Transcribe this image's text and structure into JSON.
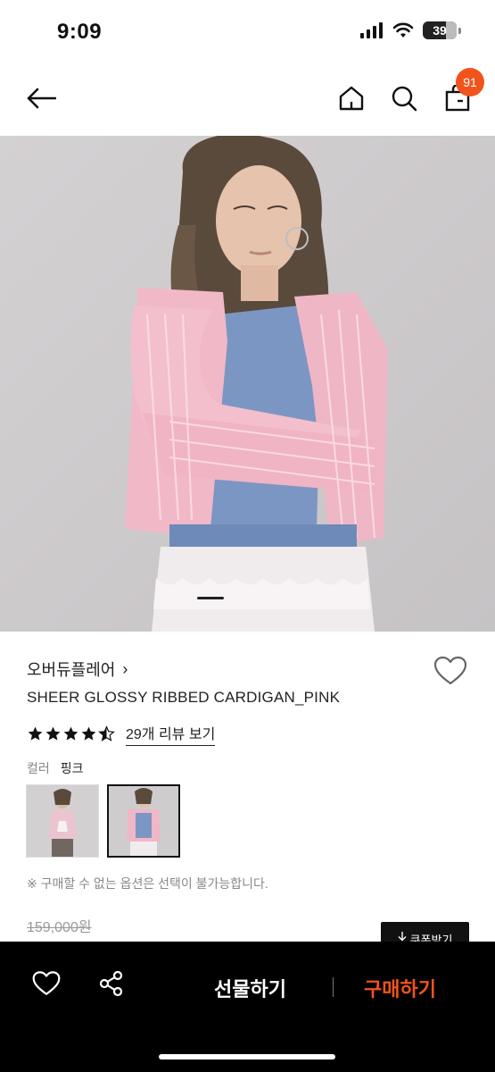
{
  "status": {
    "time": "9:09",
    "battery": "39"
  },
  "nav": {
    "cart_badge": "91"
  },
  "product": {
    "brand": "오버듀플레어",
    "brand_chevron": "›",
    "title": "SHEER GLOSSY RIBBED CARDIGAN_PINK",
    "rating": 4.5,
    "review_link": "29개 리뷰 보기",
    "color_label": "컬러",
    "color_value": "핑크",
    "notice": "※ 구매할 수 없는 옵션은 선택이 불가능합니다.",
    "original_price": "159,000원",
    "coupon_label": "쿠폰받기"
  },
  "bottom": {
    "gift_label": "선물하기",
    "buy_label": "구매하기"
  },
  "colors": {
    "accent": "#f2531c",
    "text": "#111111",
    "muted": "#888888"
  },
  "icons": [
    "back-arrow-icon",
    "home-icon",
    "search-icon",
    "shopping-bag-icon",
    "heart-icon",
    "star-icon",
    "share-icon",
    "download-arrow-icon"
  ]
}
